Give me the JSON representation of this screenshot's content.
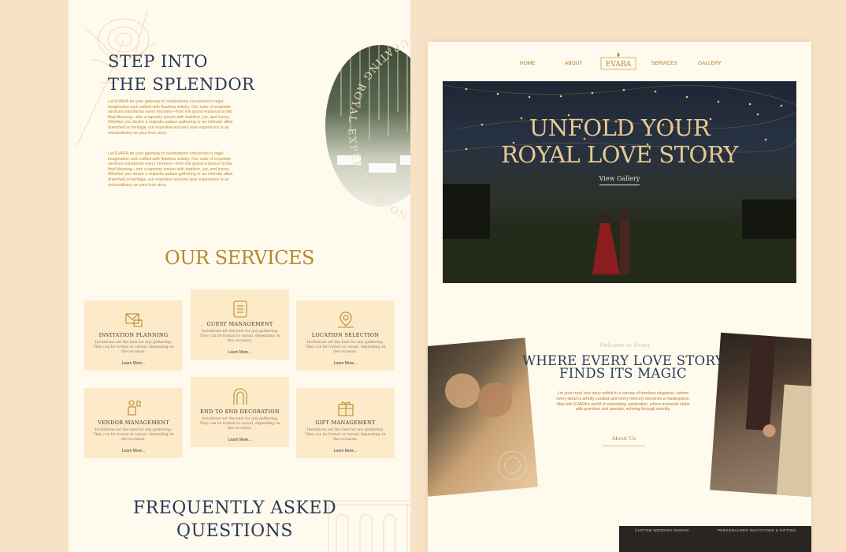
{
  "left_page": {
    "step_title_line1": "STEP INTO",
    "step_title_line2": "THE SPLENDOR",
    "paragraph1": "Let EVARA be your gateway to celebrations conceived in regal imagination and crafted with flawless artistry. Our suite of exquisite services transforms every moment—from the grand entrance to the final blessing—into a tapestry woven with tradition, joy, and luxury. Whether you desire a majestic palace gathering or an intimate affair drenched in heritage, our expertise ensures your experience is as extraordinary as your love story.",
    "paragraph2": "Let EVARA be your gateway to celebrations conceived in regal imagination and crafted with flawless artistry. Our suite of exquisite services transforms every moment—from the grand entrance to the final blessing—into a tapestry woven with tradition, joy, and luxury. Whether you desire a majestic palace gathering or an intimate affair drenched in heritage, our expertise ensures your experience is as extraordinary as your love story.",
    "arc_text": "CURATING ROYAL EXPERIENCE, ONE CELEBRATION",
    "services_title": "OUR SERVICES",
    "services": [
      {
        "title": "INVITATION PLANNING",
        "desc": "Invitations set the tone for any gathering. They can be formal or casual, depending on the occasion.",
        "link": "Learn More...",
        "icon": "envelope-icon"
      },
      {
        "title": "GUEST MANAGEMENT",
        "desc": "Invitations set the tone for any gathering. They can be formal or casual, depending on the occasion.",
        "link": "Learn More...",
        "icon": "guest-list-icon"
      },
      {
        "title": "LOCATION SELECTION",
        "desc": "Invitations set the tone for any gathering. They can be formal or casual, depending on the occasion.",
        "link": "Learn More...",
        "icon": "map-pin-icon"
      },
      {
        "title": "VENDOR MANAGEMENT",
        "desc": "Invitations set the tone for any gathering. They can be formal or casual, depending on the occasion.",
        "link": "Learn More...",
        "icon": "vendor-icon"
      },
      {
        "title": "END TO END DECORATION",
        "desc": "Invitations set the tone for any gathering. They can be formal or casual, depending on the occasion.",
        "link": "Learn More...",
        "icon": "arch-icon"
      },
      {
        "title": "GIFT MANAGEMENT",
        "desc": "Invitations set the tone for any gathering. They can be formal or casual, depending on the occasion.",
        "link": "Learn More...",
        "icon": "gift-icon"
      }
    ],
    "faq_line1": "FREQUENTLY ASKED",
    "faq_line2": "QUESTIONS"
  },
  "right_page": {
    "nav": {
      "home": "HOME",
      "about": "ABOUT",
      "services": "SERVICES",
      "gallery": "GALLERY",
      "logo": "EVARA"
    },
    "hero": {
      "line1": "UNFOLD YOUR",
      "line2": "ROYAL LOVE STORY",
      "cta": "View Gallery"
    },
    "welcome": "Welcome to Evara",
    "headline_line1": "WHERE EVERY LOVE STORY",
    "headline_line2": "FINDS ITS MAGIC",
    "description": "Let your royal love story unfold in a canvas of timeless elegance—where every detail is artfully curated and every memory becomes a masterpiece. Step into EVARA's world of everlasting celebration, where moments shine with grandeur and passion, echoing through eternity.",
    "about_button": "About Us",
    "strip_left": "CUSTOM WEDDING DESIGN",
    "strip_right": "PERSONALIZED INVITATIONS & GIFTING"
  },
  "colors": {
    "background": "#f7e2c6",
    "page": "#fffaee",
    "gold": "#b68a2e",
    "navy": "#2b3a57",
    "card": "#fdeac8"
  }
}
